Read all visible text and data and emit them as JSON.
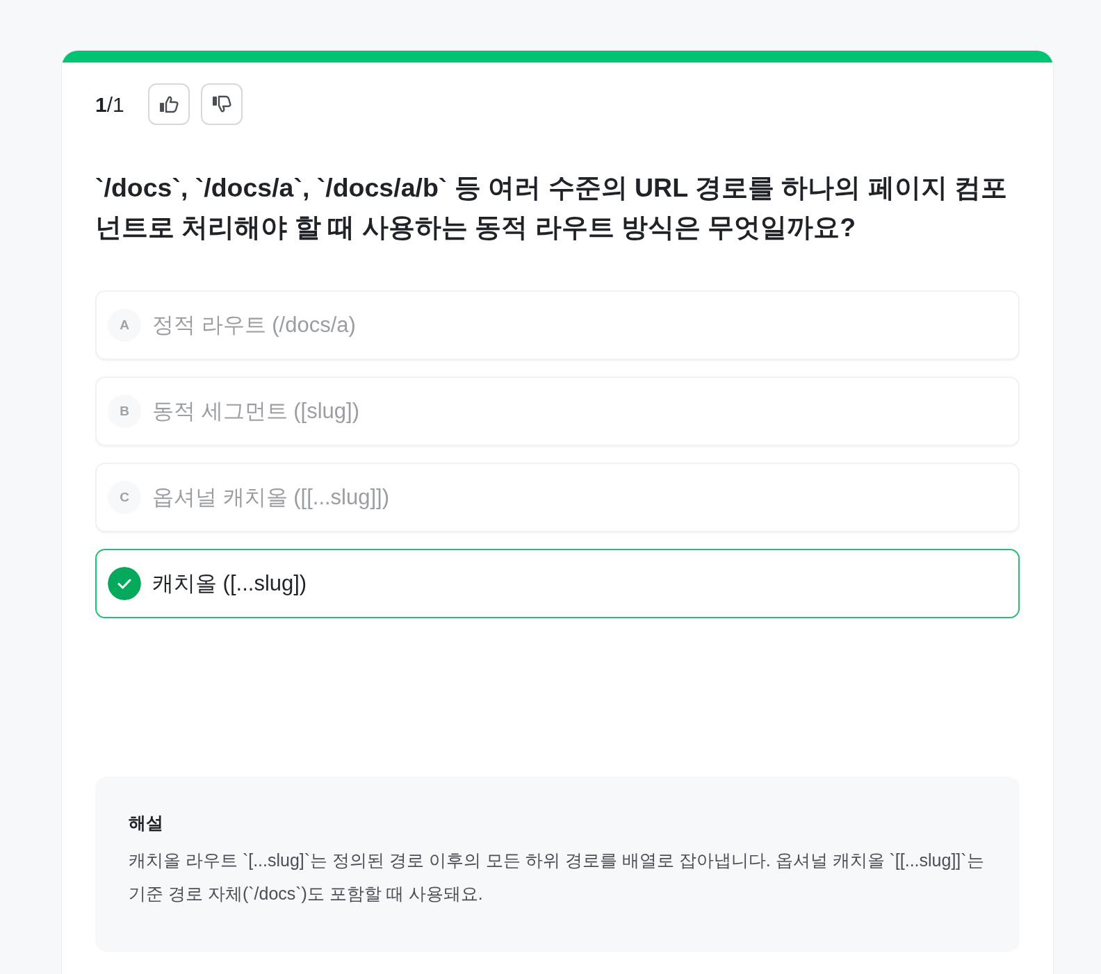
{
  "progress": {
    "level": 1
  },
  "counter": "1/1",
  "question": "`/docs`, `/docs/a`, `/docs/a/b` 등 여러 수준의 URL 경로를 하나의 페이지 컴포넌트로 처리해야 할 때 사용하는 동적 라우트 방식은 무엇일까요?",
  "options": [
    {
      "letter": "A",
      "text": "정적 라우트 (/docs/a)",
      "correct": false
    },
    {
      "letter": "B",
      "text": "동적 세그먼트 ([slug])",
      "correct": false
    },
    {
      "letter": "C",
      "text": "옵셔널 캐치올 ([[...slug]])",
      "correct": false
    },
    {
      "text": "캐치올 ([...slug])",
      "correct": true
    }
  ],
  "explanation": {
    "title": "해설",
    "text": "캐치올 라우트 `[...slug]`는 정의된 경로 이후의 모든 하위 경로를 배열로 잡아냅니다. 옵셔널 캐치올 `[[...slug]]`는 기준 경로 자체(`/docs`)도 포함할 때 사용돼요."
  }
}
